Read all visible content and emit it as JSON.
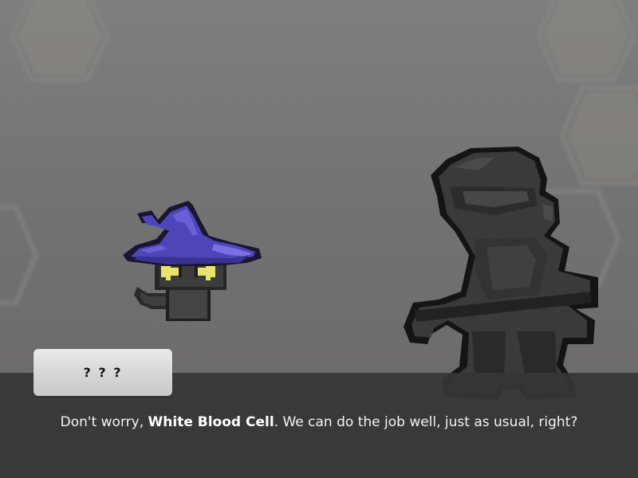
{
  "scene": {
    "background_color": "#7a7979",
    "panel_color": "#363636"
  },
  "characters": {
    "left": {
      "icon": "wizard-cat-icon",
      "hat_color": "#5a4fc4",
      "eye_color": "#e8e36a"
    },
    "right": {
      "icon": "armored-knight-silhouette-icon",
      "color": "#2e2e2e"
    }
  },
  "dialogue": {
    "speaker": "? ? ?",
    "line_before": "Don't worry, ",
    "line_emphasis": "White Blood Cell",
    "line_after": ". We can do the job well, just as usual, right?"
  }
}
